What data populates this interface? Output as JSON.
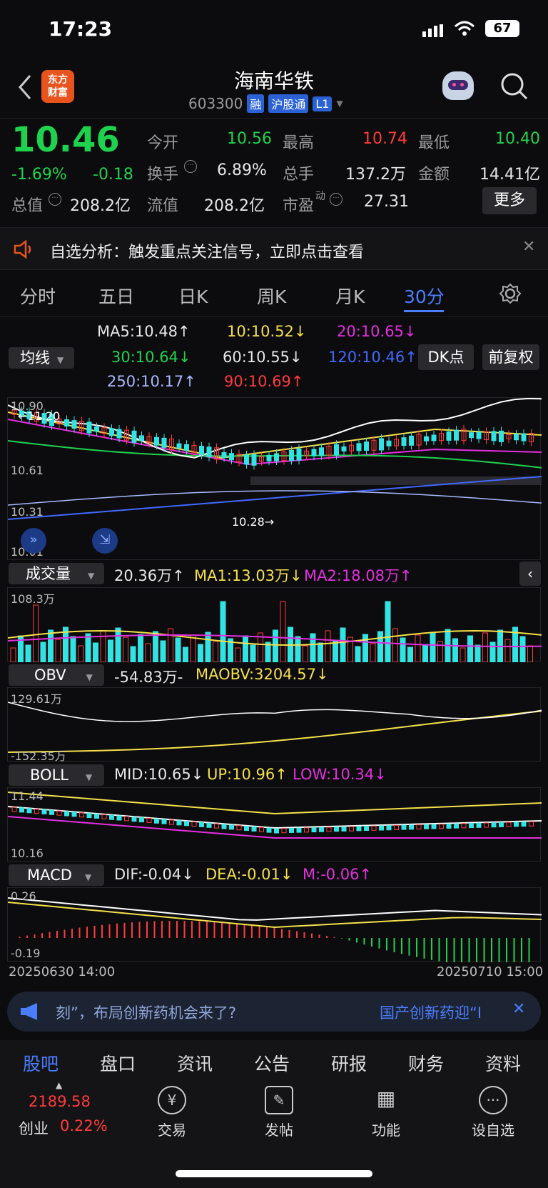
{
  "status": {
    "time": "17:23",
    "battery": "67"
  },
  "header": {
    "logo": "东方\n财富",
    "stock_name": "海南华铁",
    "code": "603300",
    "tags": [
      "融",
      "沪股通",
      "L1"
    ]
  },
  "quote": {
    "price": "10.46",
    "change_pct": "-1.69%",
    "change": "-0.18",
    "open_label": "今开",
    "open": "10.56",
    "high_label": "最高",
    "high": "10.74",
    "low_label": "最低",
    "low": "10.40",
    "turnover_label": "换手",
    "turnover": "6.89%",
    "volume_label": "总手",
    "volume": "137.2万",
    "amount_label": "金额",
    "amount": "14.41亿",
    "mcap_label": "总值",
    "mcap": "208.2亿",
    "float_label": "流值",
    "float": "208.2亿",
    "pe_label": "市盈",
    "pe_sup": "动",
    "pe": "27.31",
    "more": "更多"
  },
  "alert": {
    "text": "自选分析：触发重点关注信号，立即点击查看"
  },
  "tabs": [
    "分时",
    "五日",
    "日K",
    "周K",
    "月K",
    "30分"
  ],
  "ma": {
    "selector": "均线",
    "ma5": "MA5:10.48↑",
    "ma10": "10:10.52↓",
    "ma20": "20:10.65↓",
    "ma30": "30:10.64↓",
    "ma60": "60:10.55↓",
    "ma120": "120:10.46↑",
    "ma250": "250:10.17↑",
    "ma90": "90:10.69↑",
    "dk": "DK点",
    "fq": "前复权"
  },
  "kline": {
    "top_label": "10.90",
    "mid_label": "10.61",
    "low_label": "10.31",
    "bottom_label": "10.01",
    "min_marker": "10.28→",
    "left_marker": "←11.20"
  },
  "volume": {
    "selector": "成交量",
    "val": "20.36万↑",
    "ma1": "MA1:13.03万↓",
    "ma2": "MA2:18.08万↑",
    "max": "108.3万"
  },
  "obv": {
    "selector": "OBV",
    "val": "-54.83万-",
    "maobv": "MAOBV:3204.57↓",
    "top": "129.61万",
    "bottom": "-152.35万"
  },
  "boll": {
    "selector": "BOLL",
    "mid": "MID:10.65↓",
    "up": "UP:10.96↑",
    "low": "LOW:10.34↓",
    "top": "11.44",
    "bottom": "10.16"
  },
  "macd": {
    "selector": "MACD",
    "dif": "DIF:-0.04↓",
    "dea": "DEA:-0.01↓",
    "m": "M:-0.06↑",
    "top": "0.26",
    "bottom": "-0.19"
  },
  "dates": {
    "start": "20250630 14:00",
    "end": "20250710 15:00"
  },
  "news": {
    "left": "刻”，布局创新药机会来了?",
    "right": "国产创新药迎“I"
  },
  "bottom_tabs": [
    "股吧",
    "盘口",
    "资讯",
    "公告",
    "研报",
    "财务",
    "资料"
  ],
  "toolbar": {
    "index_value": "2189.58",
    "index_name": "创业",
    "index_pct": "0.22%",
    "trade": "交易",
    "post": "发帖",
    "func": "功能",
    "watch": "设自选"
  },
  "colors": {
    "up": "#ff3b3b",
    "down": "#1fd24d",
    "accent": "#4a7dff"
  }
}
